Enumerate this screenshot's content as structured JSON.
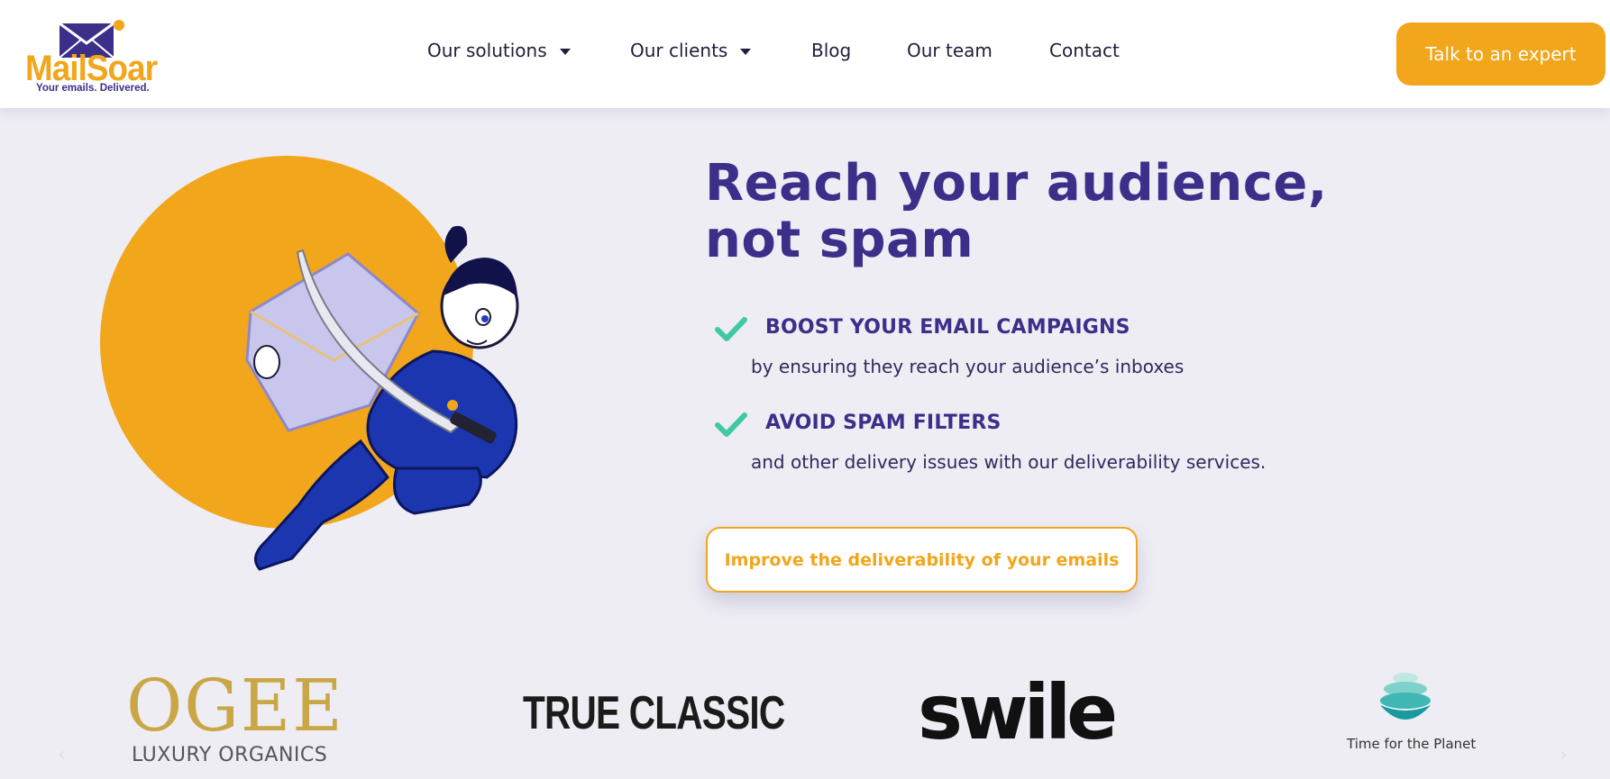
{
  "brand": {
    "name": "MailSoar",
    "tagline": "Your emails. Delivered.",
    "accent_color": "#f1a61b",
    "primary_color": "#3b2f8a"
  },
  "nav": {
    "items": [
      {
        "label": "Our solutions",
        "has_dropdown": true
      },
      {
        "label": "Our clients",
        "has_dropdown": true
      },
      {
        "label": "Blog",
        "has_dropdown": false
      },
      {
        "label": "Our team",
        "has_dropdown": false
      },
      {
        "label": "Contact",
        "has_dropdown": false
      }
    ],
    "cta_label": "Talk to an expert"
  },
  "hero": {
    "title_line1": "Reach your audience,",
    "title_line2": "not spam",
    "features": [
      {
        "title": "BOOST YOUR EMAIL CAMPAIGNS",
        "description": "by ensuring they reach your audience’s inboxes",
        "icon": "check-icon"
      },
      {
        "title": "AVOID SPAM FILTERS",
        "description": "and other delivery issues with our deliverability services.",
        "icon": "check-icon"
      }
    ],
    "cta_label": "Improve the deliverability of your emails",
    "illustration": "samurai-mascot-illustration"
  },
  "clients": {
    "logos": [
      {
        "name": "OGEE",
        "subtitle": "LUXURY ORGANICS"
      },
      {
        "name": "TRUE CLASSIC"
      },
      {
        "name": "swile"
      },
      {
        "name": "Time for the Planet",
        "icon": "planet-stack-icon"
      }
    ],
    "prev_icon": "chevron-left-icon",
    "next_icon": "chevron-right-icon"
  }
}
